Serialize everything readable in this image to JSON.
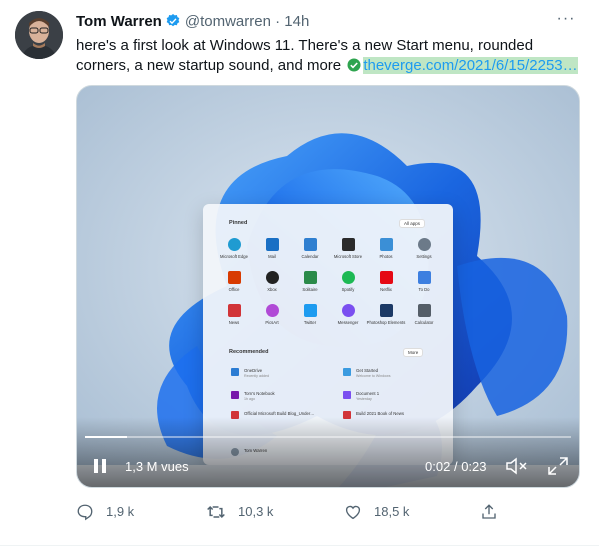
{
  "tweet": {
    "author_name": "Tom Warren",
    "handle": "@tomwarren",
    "separator": "·",
    "time": "14h",
    "text_main": "here's a first look at Windows 11. There's a new Start menu, rounded corners, a new startup sound, and more",
    "link_text": "theverge.com/2021/6/15/2253…",
    "more_icon": "more-icon"
  },
  "video": {
    "views": "1,3 M vues",
    "current_time": "0:02",
    "time_separator": "/",
    "duration": "0:23",
    "progress": 0.087,
    "start_menu": {
      "pinned_label": "Pinned",
      "all_apps_label": "All apps",
      "recommended_label": "Recommended",
      "more_label": "More",
      "user_name": "Tom Warren",
      "apps": [
        {
          "label": "Microsoft Edge",
          "color": "#1f9bd1"
        },
        {
          "label": "Mail",
          "color": "#1a6fc4"
        },
        {
          "label": "Calendar",
          "color": "#2f7fd0"
        },
        {
          "label": "Microsoft Store",
          "color": "#2b2b2b"
        },
        {
          "label": "Photos",
          "color": "#3b8fd6"
        },
        {
          "label": "Settings",
          "color": "#6c7a89"
        },
        {
          "label": "Office",
          "color": "#d83b01"
        },
        {
          "label": "Xbox",
          "color": "#222222"
        },
        {
          "label": "Solitaire",
          "color": "#2a8a4a"
        },
        {
          "label": "Spotify",
          "color": "#1db954"
        },
        {
          "label": "Netflix",
          "color": "#e50914"
        },
        {
          "label": "To Do",
          "color": "#3d7fe0"
        },
        {
          "label": "News",
          "color": "#d13438"
        },
        {
          "label": "PicsArt",
          "color": "#b04ad6"
        },
        {
          "label": "Twitter",
          "color": "#1d9bf0"
        },
        {
          "label": "Messenger",
          "color": "#7a4ff0"
        },
        {
          "label": "Photoshop Elements",
          "color": "#1c3a66"
        },
        {
          "label": "Calculator",
          "color": "#555e68"
        }
      ],
      "recommended": [
        {
          "title": "OneDrive",
          "sub": "Recently added",
          "color": "#2b7cd3"
        },
        {
          "title": "Get Started",
          "sub": "Welcome to Windows",
          "color": "#3b9be0"
        },
        {
          "title": "Tom's Notebook",
          "sub": "1h ago",
          "color": "#7719aa"
        },
        {
          "title": "Document 1",
          "sub": "Yesterday",
          "color": "#7a4ff0"
        },
        {
          "title": "Official Microsoft Build Blog_Under…",
          "sub": "",
          "color": "#d13438"
        },
        {
          "title": "Build 2021 Book of News",
          "sub": "",
          "color": "#d13438"
        }
      ]
    }
  },
  "actions": {
    "replies": "1,9 k",
    "retweets": "10,3 k",
    "likes": "18,5 k"
  },
  "colors": {
    "accent": "#1d9bf0",
    "text": "#0f1419",
    "muted": "#536471",
    "link_highlight": "#bfe6c4"
  }
}
